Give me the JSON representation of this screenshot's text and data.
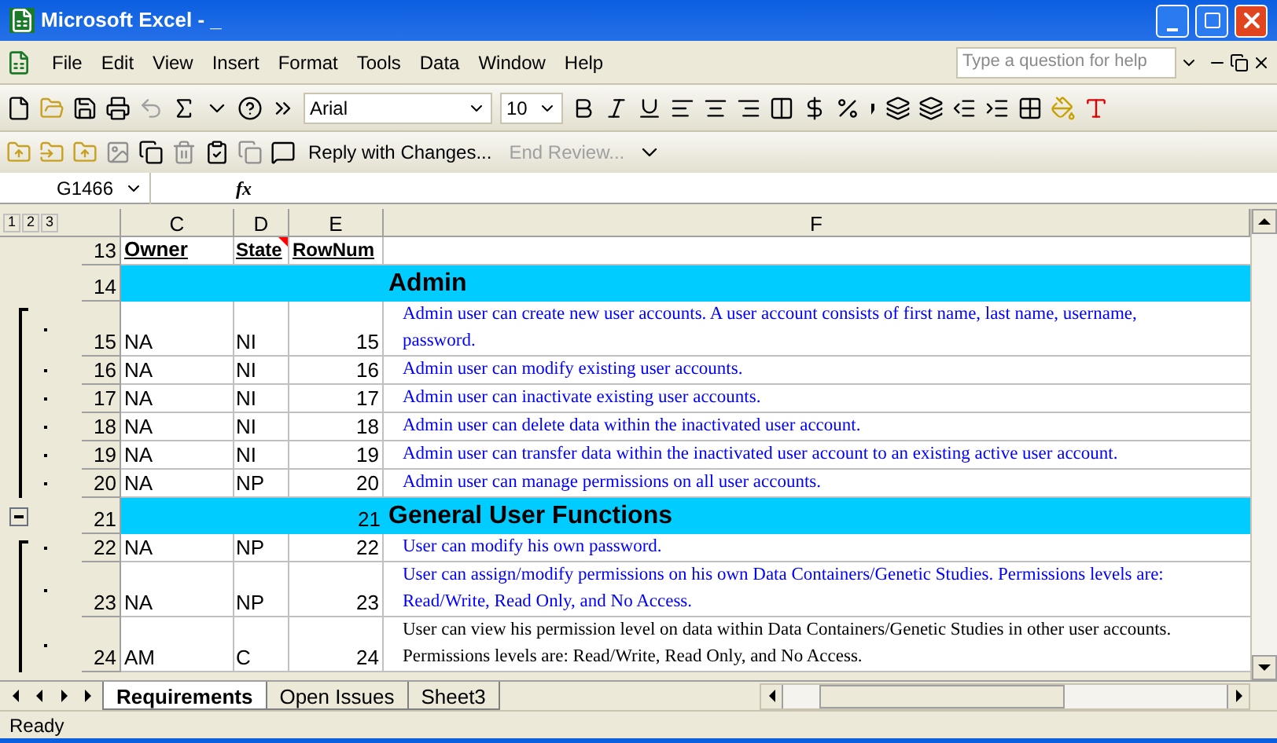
{
  "window": {
    "title": "Microsoft Excel - _"
  },
  "menu": [
    "File",
    "Edit",
    "View",
    "Insert",
    "Format",
    "Tools",
    "Data",
    "Window",
    "Help"
  ],
  "help_box": {
    "placeholder": "Type a question for help"
  },
  "formatting": {
    "font": "Arial",
    "size": "10"
  },
  "reviewing": {
    "reply": "Reply with Changes...",
    "end_review": "End Review..."
  },
  "formula_bar": {
    "name_box": "G1466",
    "fx": "fx"
  },
  "outline_levels": [
    "1",
    "2",
    "3"
  ],
  "columns": [
    "C",
    "D",
    "E",
    "F"
  ],
  "rows": [
    {
      "kind": "header",
      "num": "13",
      "owner": "Owner",
      "state": "State",
      "rownum": "RowNum"
    },
    {
      "kind": "section",
      "num": "14",
      "title": "Admin",
      "collapsible": false
    },
    {
      "kind": "item",
      "num": "15",
      "owner": "NA",
      "state": "NI",
      "rownum": "15",
      "text": "Admin user can create new user accounts.  A user account consists of first name, last name, username, password.",
      "color": "#0000ff"
    },
    {
      "kind": "item",
      "num": "16",
      "owner": "NA",
      "state": "NI",
      "rownum": "16",
      "text": "Admin user can modify existing user accounts.",
      "color": "#0000ff"
    },
    {
      "kind": "item",
      "num": "17",
      "owner": "NA",
      "state": "NI",
      "rownum": "17",
      "text": "Admin user can inactivate existing user accounts.",
      "color": "#0000ff"
    },
    {
      "kind": "item",
      "num": "18",
      "owner": "NA",
      "state": "NI",
      "rownum": "18",
      "text": "Admin user can delete data within the inactivated user account.",
      "color": "#0000ff"
    },
    {
      "kind": "item",
      "num": "19",
      "owner": "NA",
      "state": "NI",
      "rownum": "19",
      "text": "Admin user can transfer data within the inactivated user account to an existing active user account.",
      "color": "#0000ff"
    },
    {
      "kind": "item",
      "num": "20",
      "owner": "NA",
      "state": "NP",
      "rownum": "20",
      "text": "Admin user can manage permissions on all user accounts.",
      "color": "#0000ff"
    },
    {
      "kind": "section",
      "num": "21",
      "rownum": "21",
      "title": "General User Functions",
      "collapsible": true
    },
    {
      "kind": "item",
      "num": "22",
      "owner": "NA",
      "state": "NP",
      "rownum": "22",
      "text": "User can modify his own password.",
      "color": "#0000ff"
    },
    {
      "kind": "item",
      "num": "23",
      "owner": "NA",
      "state": "NP",
      "rownum": "23",
      "text": "User can assign/modify permissions on his own Data Containers/Genetic Studies.  Permissions levels are: Read/Write, Read Only, and No Access.",
      "color": "#0000ff"
    },
    {
      "kind": "item",
      "num": "24",
      "owner": "AM",
      "state": "C",
      "rownum": "24",
      "text": "User can view his permission level on data within Data Containers/Genetic Studies in other user accounts.  Permissions levels are: Read/Write, Read Only, and No Access.",
      "color": "#000000"
    }
  ],
  "sheet_tabs": [
    {
      "label": "Requirements",
      "selected": true
    },
    {
      "label": "Open Issues",
      "selected": false
    },
    {
      "label": "Sheet3",
      "selected": false
    }
  ],
  "status_bar": "Ready"
}
